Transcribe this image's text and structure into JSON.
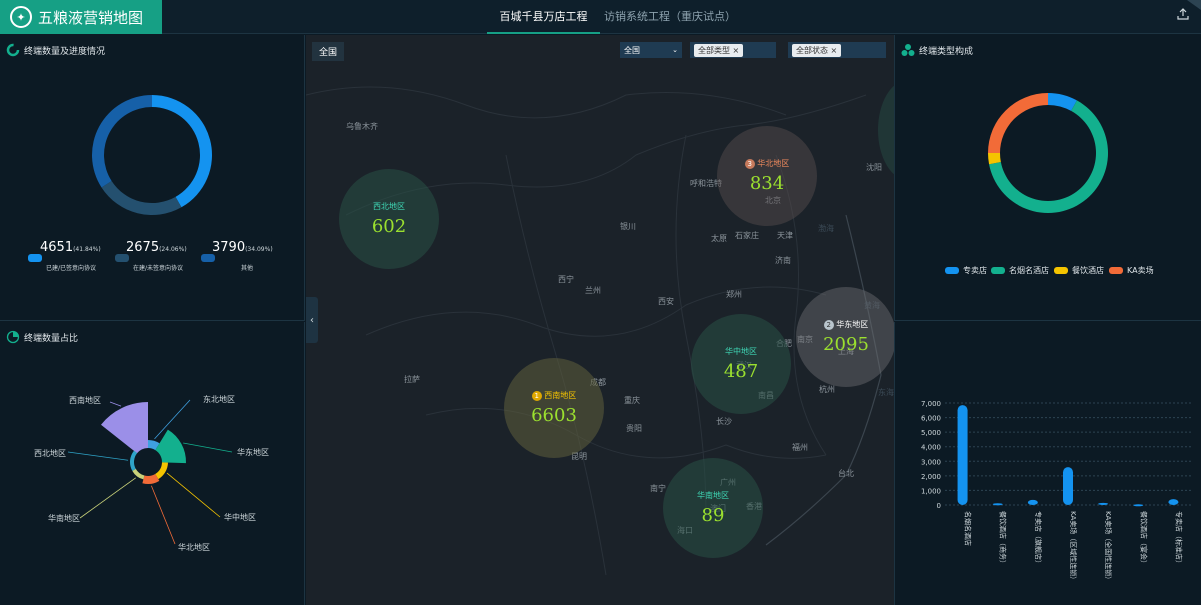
{
  "header": {
    "logo_text": "五粮液营销地图",
    "tabs": [
      {
        "label": "百城千县万店工程"
      },
      {
        "label": "访销系统工程（重庆试点）"
      }
    ],
    "export_icon": "export-icon"
  },
  "progress_panel": {
    "title": "终端数量及进度情况",
    "colors": {
      "signed": "#1493f0",
      "not_signed": "#24506f",
      "other": "#1660a8"
    },
    "stats": [
      {
        "value": "4651",
        "pct": "(41.84%)",
        "label": "已建/已签意向协议"
      },
      {
        "value": "2675",
        "pct": "(24.06%)",
        "label": "在建/未签意向协议"
      },
      {
        "value": "3790",
        "pct": "(34.09%)",
        "label": "其他"
      }
    ]
  },
  "region_panel": {
    "title": "终端数量占比",
    "labels": [
      "西南地区",
      "东北地区",
      "华东地区",
      "华中地区",
      "华北地区",
      "华南地区",
      "西北地区"
    ]
  },
  "map": {
    "scope_button": "全国",
    "scope_select": "全国",
    "type_chip": "全部类型",
    "status_chip": "全部状态",
    "cities": [
      "乌鲁木齐",
      "呼和浩特",
      "北京",
      "沈阳",
      "银川",
      "太原",
      "石家庄",
      "天津",
      "济南",
      "西宁",
      "兰州",
      "西安",
      "郑州",
      "合肥",
      "南京",
      "上海",
      "拉萨",
      "成都",
      "武汉",
      "杭州",
      "重庆",
      "南昌",
      "贵阳",
      "长沙",
      "福州",
      "昆明",
      "台北",
      "南宁",
      "广州",
      "澳门",
      "香港",
      "海口",
      "渤海",
      "黄海",
      "东海"
    ],
    "regions": [
      {
        "name": "西北地区",
        "value": "602"
      },
      {
        "name": "华北地区",
        "value": "834"
      },
      {
        "name": "华东地区",
        "value": "2095"
      },
      {
        "name": "华中地区",
        "value": "487"
      },
      {
        "name": "西南地区",
        "value": "6603"
      },
      {
        "name": "华南地区",
        "value": "89"
      }
    ],
    "rank_badges": [
      "1",
      "2",
      "3"
    ]
  },
  "type_panel": {
    "title": "终端类型构成",
    "legend": [
      {
        "label": "专卖店",
        "color": "#1493f0"
      },
      {
        "label": "名烟名酒店",
        "color": "#13b08e"
      },
      {
        "label": "餐饮酒店",
        "color": "#f5c400"
      },
      {
        "label": "KA卖场",
        "color": "#f26b38"
      }
    ]
  },
  "chart_data": [
    {
      "type": "pie",
      "title": "终端数量及进度情况",
      "labels": [
        "已建/已签意向协议",
        "在建/未签意向协议",
        "其他"
      ],
      "values": [
        4651,
        2675,
        3790
      ],
      "percent": [
        41.84,
        24.06,
        34.09
      ]
    },
    {
      "type": "pie",
      "title": "终端数量占比",
      "labels": [
        "西南地区",
        "华东地区",
        "华北地区",
        "华中地区",
        "华南地区",
        "西北地区",
        "东北地区"
      ],
      "values": [
        6603,
        2095,
        834,
        487,
        89,
        602,
        40
      ]
    },
    {
      "type": "pie",
      "title": "终端类型构成",
      "labels": [
        "专卖店",
        "名烟名酒店",
        "餐饮酒店",
        "KA卖场"
      ],
      "values": [
        8,
        64,
        3,
        25
      ]
    },
    {
      "type": "bar",
      "categories": [
        "名烟名酒店",
        "餐饮酒店（商务）",
        "专卖店（旗舰店）",
        "KA卖场（区域性连锁）",
        "KA卖场（全国性连锁）",
        "餐饮酒店（宴会）",
        "专卖店（标准店）"
      ],
      "values": [
        6850,
        120,
        350,
        2600,
        150,
        50,
        400
      ],
      "ylim": [
        0,
        7000
      ],
      "yticks": [
        "0",
        "1,000",
        "2,000",
        "3,000",
        "4,000",
        "5,000",
        "6,000",
        "7,000"
      ],
      "grid": true
    }
  ]
}
